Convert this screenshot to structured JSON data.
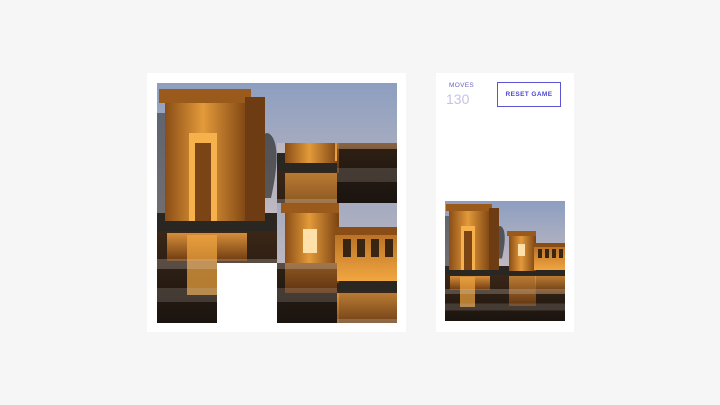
{
  "game": {
    "moves_label": "MOVES",
    "moves_count": "130",
    "reset_label": "RESET GAME"
  },
  "board": {
    "grid_size": 4,
    "tiles": [
      {
        "cell": 0,
        "piece": 0
      },
      {
        "cell": 1,
        "piece": 1
      },
      {
        "cell": 2,
        "piece": 2
      },
      {
        "cell": 3,
        "piece": 3
      },
      {
        "cell": 4,
        "piece": 4
      },
      {
        "cell": 5,
        "piece": 5
      },
      {
        "cell": 6,
        "piece": 10
      },
      {
        "cell": 7,
        "piece": 15
      },
      {
        "cell": 8,
        "piece": 8
      },
      {
        "cell": 9,
        "piece": 9
      },
      {
        "cell": 10,
        "piece": 6
      },
      {
        "cell": 11,
        "piece": 7
      },
      {
        "cell": 12,
        "piece": 12
      },
      {
        "cell": 13,
        "piece": null
      },
      {
        "cell": 14,
        "piece": 14
      },
      {
        "cell": 15,
        "piece": 11
      }
    ]
  },
  "colors": {
    "accent": "#5b55d6",
    "sky_top": "#8e9fc2",
    "sky_bottom": "#e8c9a8",
    "stone_lit": "#d68a2c",
    "stone_dark": "#5b3210",
    "water": "#2b1e14"
  }
}
